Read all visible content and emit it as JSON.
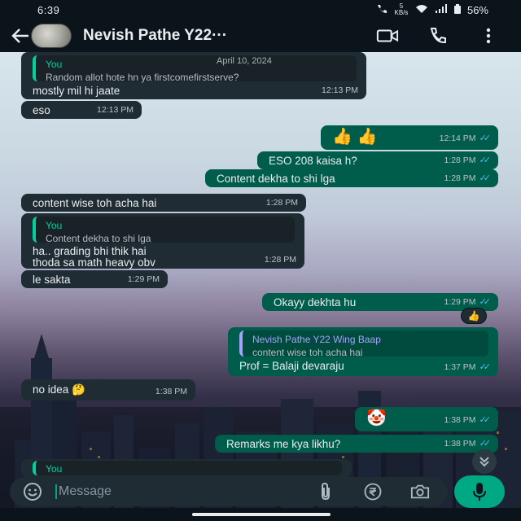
{
  "status_bar": {
    "time": "6:39",
    "network_speed": "5 KB/s",
    "battery": "56%"
  },
  "header": {
    "contact_name": "Nevish Pathe Y22···",
    "icons": [
      "back-arrow-icon",
      "video-call-icon",
      "voice-call-icon",
      "more-vert-icon"
    ]
  },
  "colors": {
    "incoming_bubble": "#202c33",
    "outgoing_bubble": "#005c4b",
    "accent": "#00a884",
    "read_ticks": "#53bdeb"
  },
  "messages": [
    {
      "id": "m1",
      "direction": "in",
      "quote_author": "You",
      "quote_text": "Random allot hote hn ya firstcomefirstserve?",
      "date_label": "April 10, 2024",
      "text": "mostly mil hi jaate",
      "time": "12:13 PM"
    },
    {
      "id": "m2",
      "direction": "in",
      "text": "eso",
      "time": "12:13 PM"
    },
    {
      "id": "m3",
      "direction": "out",
      "text": "👍 👍",
      "time": "12:14 PM",
      "read": true
    },
    {
      "id": "m4",
      "direction": "out",
      "text": "ESO 208 kaisa h?",
      "time": "1:28 PM",
      "read": true
    },
    {
      "id": "m5",
      "direction": "out",
      "text": "Content dekha to shi lga",
      "time": "1:28 PM",
      "read": true
    },
    {
      "id": "m6",
      "direction": "in",
      "text": "content wise toh acha hai",
      "time": "1:28 PM"
    },
    {
      "id": "m7",
      "direction": "in",
      "quote_author": "You",
      "quote_text": "Content dekha to shi lga",
      "text_line1": "ha.. grading bhi thik hai",
      "text_line2": "thoda sa math heavy obv",
      "time": "1:28 PM"
    },
    {
      "id": "m8",
      "direction": "in",
      "text": "le sakta",
      "time": "1:29 PM"
    },
    {
      "id": "m9",
      "direction": "out",
      "text": "Okayy dekhta hu",
      "time": "1:29 PM",
      "read": true,
      "reaction": "👍"
    },
    {
      "id": "m10",
      "direction": "out",
      "quote_author": "Nevish Pathe Y22 Wing Baap",
      "quote_text": "content wise toh acha hai",
      "text": "Prof = Balaji devaraju",
      "time": "1:37 PM",
      "read": true
    },
    {
      "id": "m11",
      "direction": "in",
      "text": "no idea 🤔",
      "time": "1:38 PM"
    },
    {
      "id": "m12",
      "direction": "out",
      "text": "🤡",
      "time": "1:38 PM",
      "read": true
    },
    {
      "id": "m13",
      "direction": "out",
      "text": "Remarks me kya likhu?",
      "time": "1:38 PM",
      "read": true
    },
    {
      "id": "m14",
      "direction": "in",
      "quote_author": "You"
    }
  ],
  "input": {
    "placeholder": "Message"
  }
}
